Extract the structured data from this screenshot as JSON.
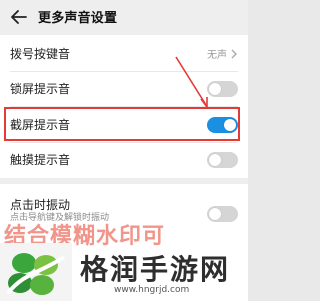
{
  "header": {
    "back_icon": "back-arrow-icon",
    "title": "更多声音设置"
  },
  "settings": {
    "dial_tone": {
      "label": "拨号按键音",
      "value": "无声",
      "icon": "chevron-right-icon"
    },
    "lock_sound": {
      "label": "锁屏提示音",
      "enabled": false
    },
    "screenshot_sound": {
      "label": "截屏提示音",
      "enabled": true
    },
    "touch_sound": {
      "label": "触摸提示音",
      "enabled": false
    },
    "haptic": {
      "label": "点击时振动",
      "sublabel": "点击导航键及解锁时振动",
      "enabled": false
    }
  },
  "watermark": {
    "overlay_text": "结合模糊水印可",
    "site_name": "格润手游网",
    "url": "www.hngrjd.com",
    "logo_icon": "clover-logo-icon"
  },
  "colors": {
    "accent": "#1b8fe0",
    "annotation": "#e53935",
    "logo_green": "#3aa63c"
  }
}
